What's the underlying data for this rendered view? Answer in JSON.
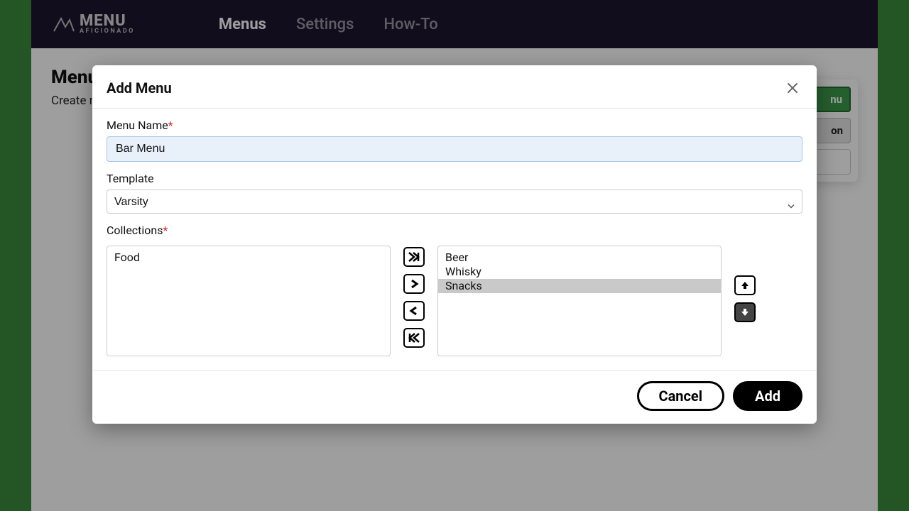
{
  "brand": {
    "top": "MENU",
    "bottom": "AFICIONADO"
  },
  "nav": {
    "menus": "Menus",
    "settings": "Settings",
    "howto": "How-To"
  },
  "bg": {
    "heading": "Menu",
    "subtext": "Create m",
    "side_btn1_tail": "nu",
    "side_btn2_tail": "on"
  },
  "modal": {
    "title": "Add Menu",
    "menu_name_label": "Menu Name",
    "menu_name_value": "Bar Menu",
    "template_label": "Template",
    "template_value": "Varsity",
    "collections_label": "Collections",
    "available": [
      "Food"
    ],
    "selected": [
      "Beer",
      "Whisky",
      "Snacks"
    ],
    "selected_index": 2,
    "cancel": "Cancel",
    "add": "Add"
  }
}
